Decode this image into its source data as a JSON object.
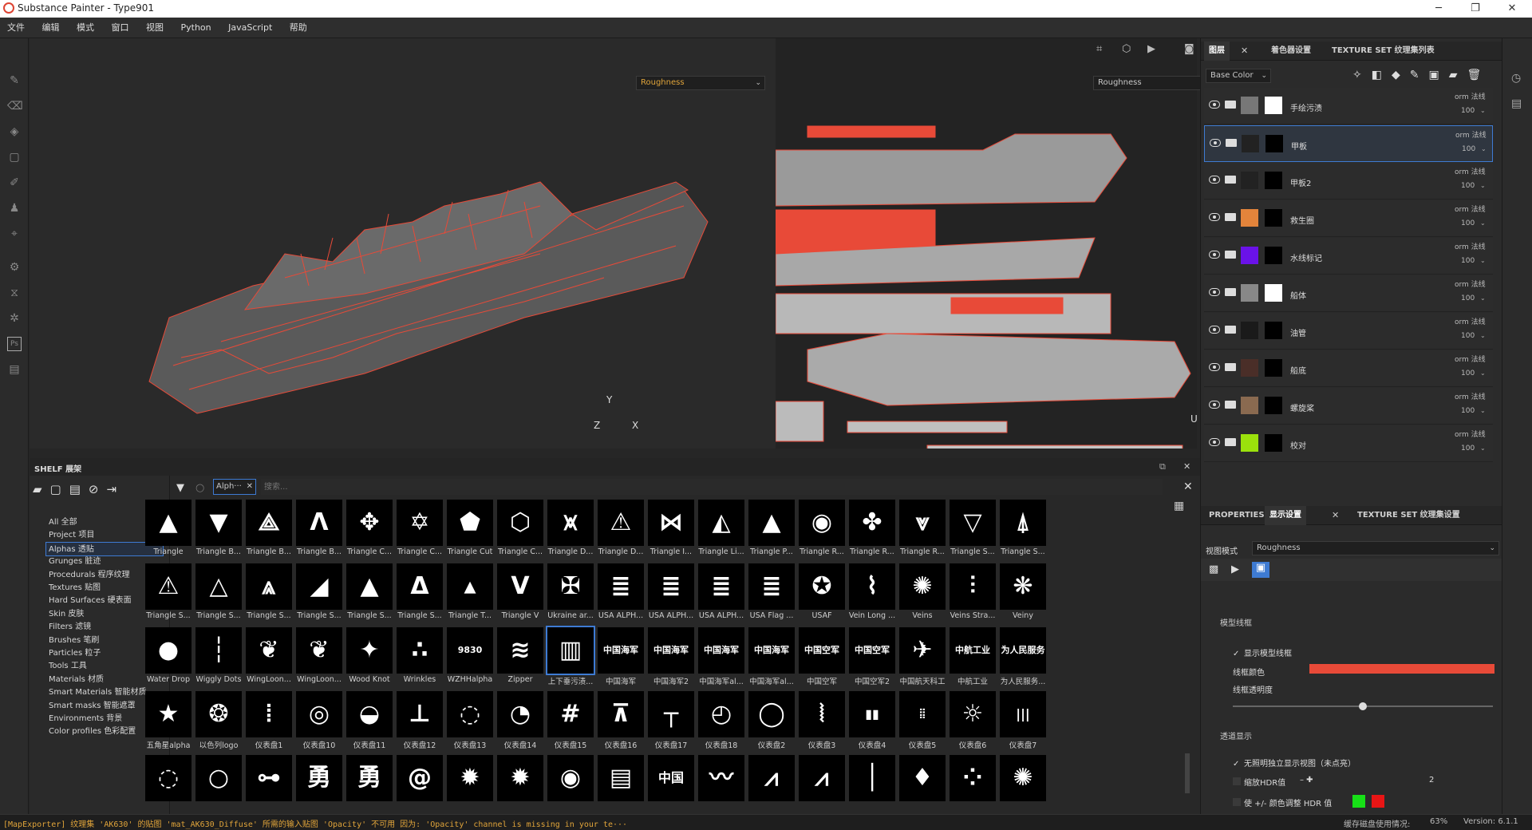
{
  "window": {
    "title": "Substance Painter - Type901",
    "minimize": "─",
    "maximize": "❐",
    "close": "✕"
  },
  "menu": [
    "文件",
    "编辑",
    "模式",
    "窗口",
    "视图",
    "Python",
    "JavaScript",
    "帮助"
  ],
  "viewport3d": {
    "channel": "Roughness"
  },
  "viewport2d": {
    "channel": "Roughness",
    "axis_x": "X",
    "axis_y": "Y",
    "axis_z": "Z",
    "axis_u": "U"
  },
  "layers_panel": {
    "tabs": [
      "图层",
      "着色器设置",
      "TEXTURE SET 纹理集列表"
    ],
    "channel_select": "Base Color",
    "layers": [
      {
        "name": "手绘污渍",
        "blend": "orm 法线",
        "opacity": "100",
        "thumb": "#777",
        "mask": "#fff"
      },
      {
        "name": "甲板",
        "blend": "orm 法线",
        "opacity": "100",
        "thumb": "#222",
        "mask": "#000"
      },
      {
        "name": "甲板2",
        "blend": "orm 法线",
        "opacity": "100",
        "thumb": "#222",
        "mask": "#000"
      },
      {
        "name": "救生圈",
        "blend": "orm 法线",
        "opacity": "100",
        "thumb": "#e3843b",
        "mask": "#000"
      },
      {
        "name": "水线标记",
        "blend": "orm 法线",
        "opacity": "100",
        "thumb": "#6a12e8",
        "mask": "#000"
      },
      {
        "name": "船体",
        "blend": "orm 法线",
        "opacity": "100",
        "thumb": "#888",
        "mask": "#fff"
      },
      {
        "name": "油管",
        "blend": "orm 法线",
        "opacity": "100",
        "thumb": "#1a1a1a",
        "mask": "#000"
      },
      {
        "name": "船底",
        "blend": "orm 法线",
        "opacity": "100",
        "thumb": "#4a2e28",
        "mask": "#000"
      },
      {
        "name": "螺旋桨",
        "blend": "orm 法线",
        "opacity": "100",
        "thumb": "#8a6a50",
        "mask": "#000"
      },
      {
        "name": "校对",
        "blend": "orm 法线",
        "opacity": "100",
        "thumb": "#9be10c",
        "mask": "#000"
      }
    ]
  },
  "props_panel": {
    "tabs": [
      "PROPERTIES",
      "显示设置",
      "TEXTURE SET 纹理集设置"
    ],
    "view_mode_label": "视图模式",
    "view_mode": "Roughness",
    "section_wire": "模型线框",
    "show_wire": "显示模型线框",
    "wire_color_label": "线框颜色",
    "wire_opacity_label": "线框透明度",
    "section_trans": "透道显示",
    "unlit": "无照明独立显示视图（未点亮）",
    "hdr_label": "缩放HDR值",
    "hdr_value": "2",
    "hdr_adjust": "使 +/- 颜色调整 HDR 值",
    "wire_color": "#e84a38"
  },
  "shelf": {
    "title": "SHELF 展架",
    "filter_chip": "Alph···",
    "search_placeholder": "搜索...",
    "tree": [
      "All 全部",
      "Project 项目",
      "Alphas 透贴",
      "Grunges 脏迹",
      "Procedurals 程序纹理",
      "Textures 贴图",
      "Hard Surfaces 硬表面",
      "Skin 皮肤",
      "Filters 滤镜",
      "Brushes 笔刷",
      "Particles 粒子",
      "Tools 工具",
      "Materials 材质",
      "Smart Materials 智能材质",
      "Smart masks 智能遮罩",
      "Environments 背景",
      "Color profiles 色彩配置"
    ],
    "tiles": [
      [
        {
          "g": "▲",
          "l": "Triangle"
        },
        {
          "g": "▼",
          "l": "Triangle B..."
        },
        {
          "g": "⟁",
          "l": "Triangle B..."
        },
        {
          "g": "Λ",
          "l": "Triangle B..."
        },
        {
          "g": "✥",
          "l": "Triangle C..."
        },
        {
          "g": "✡",
          "l": "Triangle C..."
        },
        {
          "g": "⬟",
          "l": "Triangle Cut"
        },
        {
          "g": "⬡",
          "l": "Triangle C..."
        },
        {
          "g": "⩙",
          "l": "Triangle D..."
        },
        {
          "g": "⚠",
          "l": "Triangle D..."
        },
        {
          "g": "⋈",
          "l": "Triangle I..."
        },
        {
          "g": "◭",
          "l": "Triangle Li..."
        },
        {
          "g": "▲",
          "l": "Triangle P..."
        },
        {
          "g": "◉",
          "l": "Triangle R..."
        },
        {
          "g": "✤",
          "l": "Triangle R..."
        },
        {
          "g": "⩔",
          "l": "Triangle R..."
        },
        {
          "g": "▽",
          "l": "Triangle S..."
        },
        {
          "g": "⍋",
          "l": "Triangle S..."
        }
      ],
      [
        {
          "g": "⚠",
          "l": "Triangle S..."
        },
        {
          "g": "△",
          "l": "Triangle S..."
        },
        {
          "g": "⩓",
          "l": "Triangle S..."
        },
        {
          "g": "◢",
          "l": "Triangle S..."
        },
        {
          "g": "▲",
          "l": "Triangle S..."
        },
        {
          "g": "Δ",
          "l": "Triangle S..."
        },
        {
          "g": "▴",
          "l": "Triangle T..."
        },
        {
          "g": "V",
          "l": "Triangle V"
        },
        {
          "g": "✠",
          "l": "Ukraine ar..."
        },
        {
          "g": "≣",
          "l": "USA ALPH..."
        },
        {
          "g": "≣",
          "l": "USA ALPH..."
        },
        {
          "g": "≣",
          "l": "USA ALPH..."
        },
        {
          "g": "≣",
          "l": "USA Flag ..."
        },
        {
          "g": "✪",
          "l": "USAF"
        },
        {
          "g": "⌇",
          "l": "Vein Long ..."
        },
        {
          "g": "✺",
          "l": "Veins"
        },
        {
          "g": "⫶",
          "l": "Veins Stra..."
        },
        {
          "g": "❋",
          "l": "Veiny"
        }
      ],
      [
        {
          "g": "●",
          "l": "Water Drop"
        },
        {
          "g": "┆",
          "l": "Wiggly Dots"
        },
        {
          "g": "❦",
          "l": "WingLoon..."
        },
        {
          "g": "❦",
          "l": "WingLoon..."
        },
        {
          "g": "✦",
          "l": "Wood Knot"
        },
        {
          "g": "∴",
          "l": "Wrinkles"
        },
        {
          "g": "9830",
          "l": "WZHHalpha"
        },
        {
          "g": "≋",
          "l": "Zipper"
        },
        {
          "g": "▥",
          "l": "上下垂污渍..."
        },
        {
          "g": "中国海军",
          "l": "中国海军"
        },
        {
          "g": "中国海军",
          "l": "中国海军2"
        },
        {
          "g": "中国海军",
          "l": "中国海军al..."
        },
        {
          "g": "中国海军",
          "l": "中国海军al..."
        },
        {
          "g": "中国空军",
          "l": "中国空军"
        },
        {
          "g": "中国空军",
          "l": "中国空军2"
        },
        {
          "g": "✈",
          "l": "中国航天科工"
        },
        {
          "g": "中航工业",
          "l": "中航工业"
        },
        {
          "g": "为人民服务",
          "l": "为人民服务..."
        }
      ],
      [
        {
          "g": "★",
          "l": "五角星alpha"
        },
        {
          "g": "❂",
          "l": "以色列logo"
        },
        {
          "g": "⦙",
          "l": "仪表盘1"
        },
        {
          "g": "◎",
          "l": "仪表盘10"
        },
        {
          "g": "◒",
          "l": "仪表盘11"
        },
        {
          "g": "⊥",
          "l": "仪表盘12"
        },
        {
          "g": "◌",
          "l": "仪表盘13"
        },
        {
          "g": "◔",
          "l": "仪表盘14"
        },
        {
          "g": "#",
          "l": "仪表盘15"
        },
        {
          "g": "⊼",
          "l": "仪表盘16"
        },
        {
          "g": "┬",
          "l": "仪表盘17"
        },
        {
          "g": "◴",
          "l": "仪表盘18"
        },
        {
          "g": "◯",
          "l": "仪表盘2"
        },
        {
          "g": "⦚",
          "l": "仪表盘3"
        },
        {
          "g": "▮▮",
          "l": "仪表盘4"
        },
        {
          "g": "⦙⦙",
          "l": "仪表盘5"
        },
        {
          "g": "☼",
          "l": "仪表盘6"
        },
        {
          "g": "|||",
          "l": "仪表盘7"
        }
      ],
      [
        {
          "g": "◌",
          "l": ""
        },
        {
          "g": "○",
          "l": ""
        },
        {
          "g": "⊶",
          "l": ""
        },
        {
          "g": "勇",
          "l": ""
        },
        {
          "g": "勇",
          "l": ""
        },
        {
          "g": "@",
          "l": ""
        },
        {
          "g": "✹",
          "l": ""
        },
        {
          "g": "✹",
          "l": ""
        },
        {
          "g": "◉",
          "l": ""
        },
        {
          "g": "▤",
          "l": ""
        },
        {
          "g": "中国",
          "l": ""
        },
        {
          "g": "〰",
          "l": ""
        },
        {
          "g": "⩘",
          "l": ""
        },
        {
          "g": "⩘",
          "l": ""
        },
        {
          "g": "│",
          "l": ""
        },
        {
          "g": "♦",
          "l": ""
        },
        {
          "g": "⁘",
          "l": ""
        },
        {
          "g": "✺",
          "l": ""
        }
      ]
    ]
  },
  "status": {
    "message": "[MapExporter] 纹理集 'AK630' 的贴图 'mat_AK630_Diffuse' 所需的输入贴图 'Opacity' 不可用 因为: 'Opacity' channel is missing in your te···",
    "cache_label": "缓存磁盘使用情况:",
    "cache_value": "63%",
    "version": "Version: 6.1.1"
  }
}
